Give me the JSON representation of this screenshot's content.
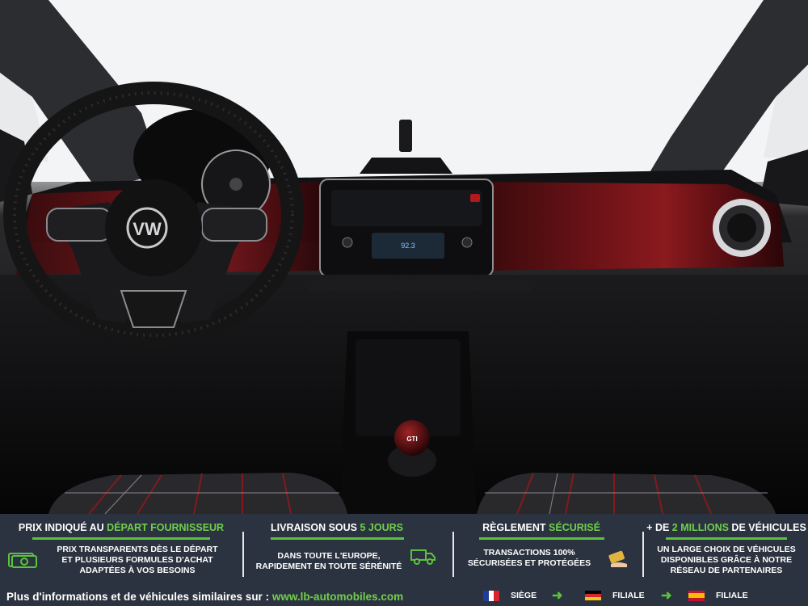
{
  "photo": {
    "subject": "volkswagen-up-gti-dashboard-interior",
    "steering_logo": "VW",
    "radio_display": "92.3"
  },
  "banner": {
    "columns": [
      {
        "title_before": "PRIX INDIQUÉ AU ",
        "title_highlight": "DÉPART FOURNISSEUR",
        "title_after": "",
        "lines": [
          "PRIX TRANSPARENTS DÈS LE DÉPART",
          "ET PLUSIEURS FORMULES D'ACHAT",
          "ADAPTÉES À VOS BESOINS"
        ],
        "icon": "money-icon"
      },
      {
        "title_before": "LIVRAISON SOUS ",
        "title_highlight": "5 JOURS",
        "title_after": "",
        "lines": [
          "DANS TOUTE L'EUROPE,",
          "RAPIDEMENT EN TOUTE SÉRÉNITÉ"
        ],
        "icon": "delivery-truck-icon"
      },
      {
        "title_before": "RÈGLEMENT ",
        "title_highlight": "SÉCURISÉ",
        "title_after": "",
        "lines": [
          "TRANSACTIONS 100%",
          "SÉCURISÉES ET PROTÉGÉES"
        ],
        "icon": "secure-payment-icon"
      },
      {
        "title_before": "+ DE ",
        "title_highlight": "2 MILLIONS",
        "title_after": " DE VÉHICULES",
        "lines": [
          "UN LARGE CHOIX DE VÉHICULES",
          "DISPONIBLES GRÂCE À NOTRE",
          "RÉSEAU DE PARTENAIRES"
        ],
        "icon": ""
      }
    ],
    "footer_text": "Plus d'informations et de véhicules similaires sur : ",
    "footer_url": "www.lb-automobiles.com",
    "flags": [
      {
        "label": "SIÈGE",
        "colors": [
          "#1f3d99",
          "#ffffff",
          "#d9262c"
        ]
      },
      {
        "label": "FILIALE",
        "colors": [
          "#000000",
          "#d9262c",
          "#f2c51d"
        ]
      },
      {
        "label": "FILIALE",
        "colors": [
          "#c8102e",
          "#f1bf00",
          "#c8102e"
        ]
      }
    ],
    "colors": {
      "background": "#2c3340",
      "accent": "#5cc23e"
    }
  }
}
